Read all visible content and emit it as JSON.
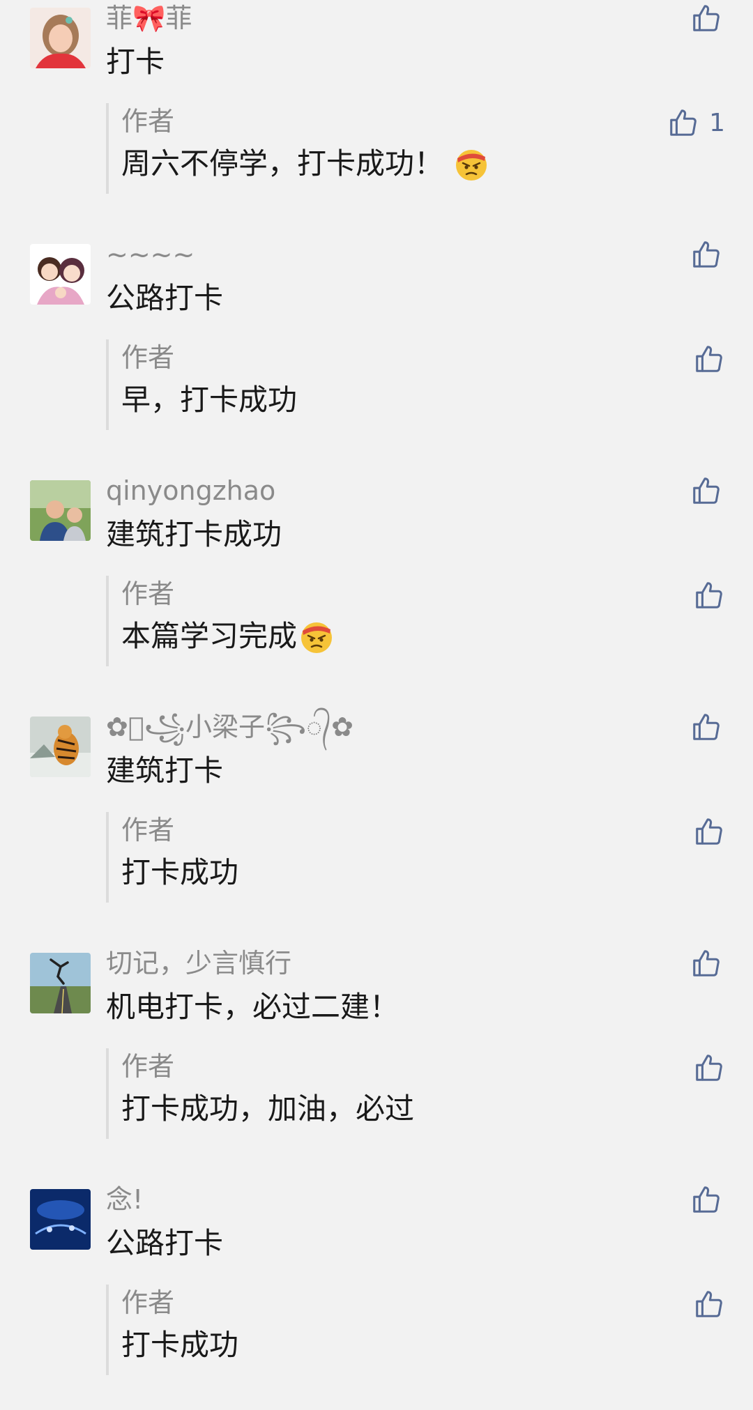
{
  "colors": {
    "background": "#f2f2f2",
    "nickname": "#8a8a8a",
    "text": "#191919",
    "like": "#576b95",
    "reply_bar": "#dcdcdc"
  },
  "comments": [
    {
      "nickname": "菲🎀菲",
      "text": "打卡",
      "like_icon": "thumbs-up-icon",
      "reply": {
        "author": "作者",
        "text": "周六不停学，打卡成功！",
        "emoji": "angry-ninja-emoji",
        "like_count": "1"
      }
    },
    {
      "nickname": "~~~~",
      "text": "公路打卡",
      "like_icon": "thumbs-up-icon",
      "reply": {
        "author": "作者",
        "text": "早，打卡成功"
      }
    },
    {
      "nickname": "qinyongzhao",
      "text": "建筑打卡成功",
      "like_icon": "thumbs-up-icon",
      "reply": {
        "author": "作者",
        "text": "本篇学习完成",
        "emoji": "angry-ninja-emoji"
      }
    },
    {
      "nickname": "✿᭄꧁小梁子꧂᭄✿",
      "text": "建筑打卡",
      "like_icon": "thumbs-up-icon",
      "reply": {
        "author": "作者",
        "text": "打卡成功"
      }
    },
    {
      "nickname": "切记，少言慎行",
      "text": "机电打卡，必过二建！",
      "like_icon": "thumbs-up-icon",
      "reply": {
        "author": "作者",
        "text": "打卡成功，加油，必过"
      }
    },
    {
      "nickname": "念!",
      "text": "公路打卡",
      "like_icon": "thumbs-up-icon",
      "reply": {
        "author": "作者",
        "text": "打卡成功"
      }
    }
  ]
}
